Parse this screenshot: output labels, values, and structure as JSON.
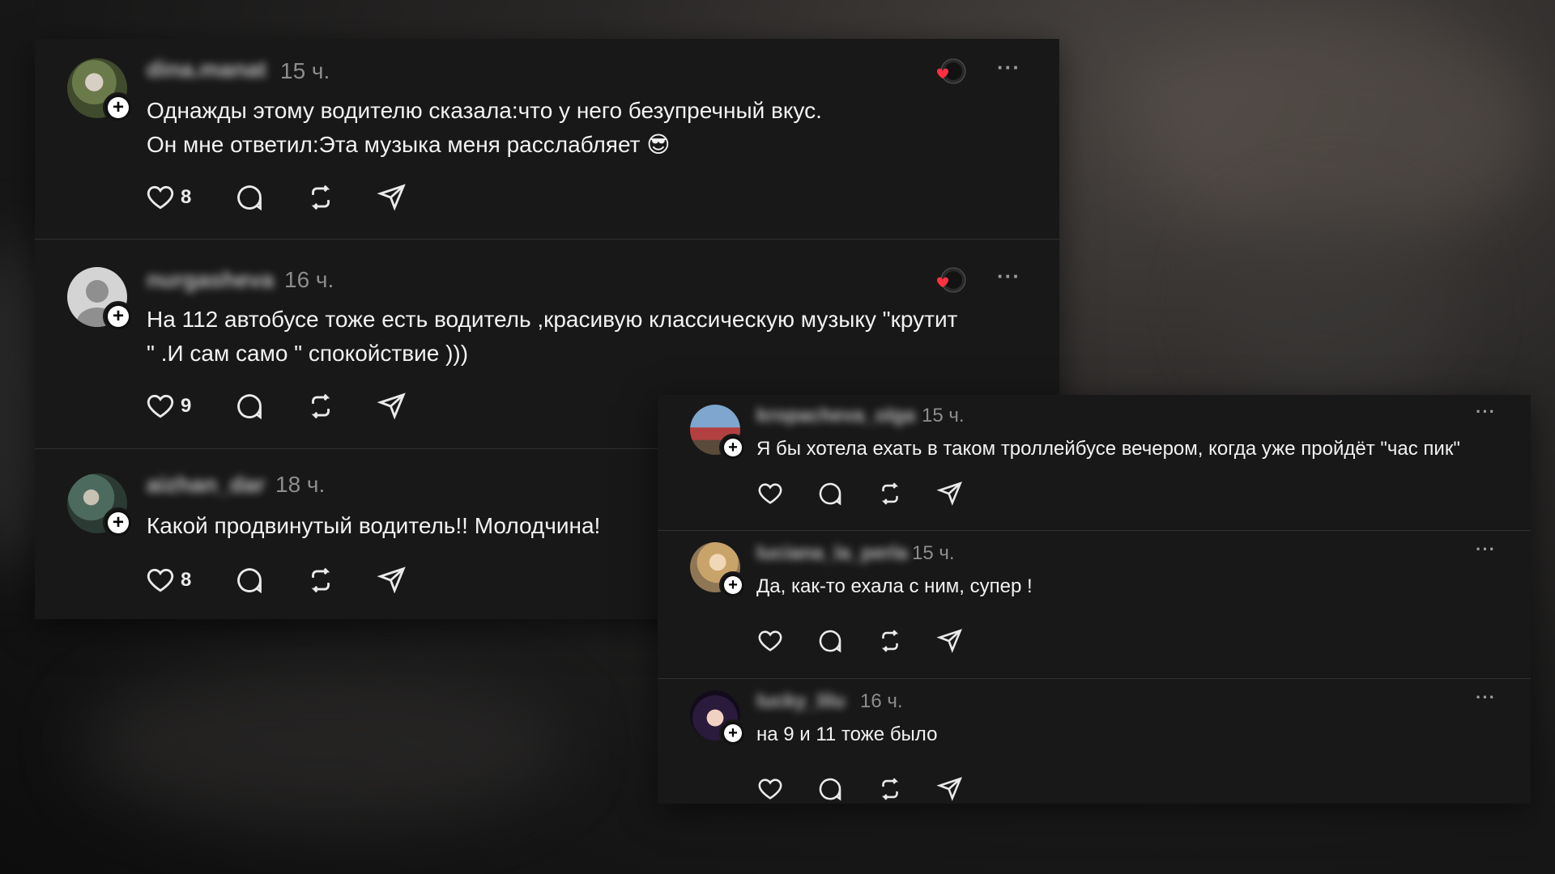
{
  "left_panel": {
    "posts": [
      {
        "username": "dina.manat",
        "time": "15 ч.",
        "text": "Однажды этому водителю сказала:что у него безупречный вкус.\nОн мне ответил:Эта музыка меня расслабляет 😎",
        "likes": "8",
        "liked_by_author": true
      },
      {
        "username": "nurgasheva",
        "time": "16 ч.",
        "text": "На 112 автобусе тоже есть водитель ,красивую классическую музыку \"крутит\n\" .И сам само \" спокойствие )))",
        "likes": "9",
        "liked_by_author": true
      },
      {
        "username": "aizhan_dar",
        "time": "18 ч.",
        "text": "Какой продвинутый водитель!! Молодчина!",
        "likes": "8",
        "liked_by_author": false
      }
    ]
  },
  "right_panel": {
    "posts": [
      {
        "username": "kropacheva_olga",
        "time": "15 ч.",
        "text": "Я бы хотела ехать в таком троллейбусе вечером, когда уже пройдёт \"час пик\""
      },
      {
        "username": "luciana_la_perla",
        "time": "15 ч.",
        "text": "Да, как-то ехала с ним, супер !"
      },
      {
        "username": "lucky_lilu",
        "time": "16 ч.",
        "text": "на 9 и 11 тоже было"
      }
    ]
  },
  "ui": {
    "more_label": "···",
    "icons": [
      "heart-icon",
      "comment-icon",
      "repost-icon",
      "share-icon",
      "add-follow-icon",
      "more-icon"
    ],
    "colors": {
      "panel_bg": "#181818",
      "text": "#f2f2f2",
      "muted": "#8d8d8d",
      "like_red": "#ff3040"
    }
  }
}
